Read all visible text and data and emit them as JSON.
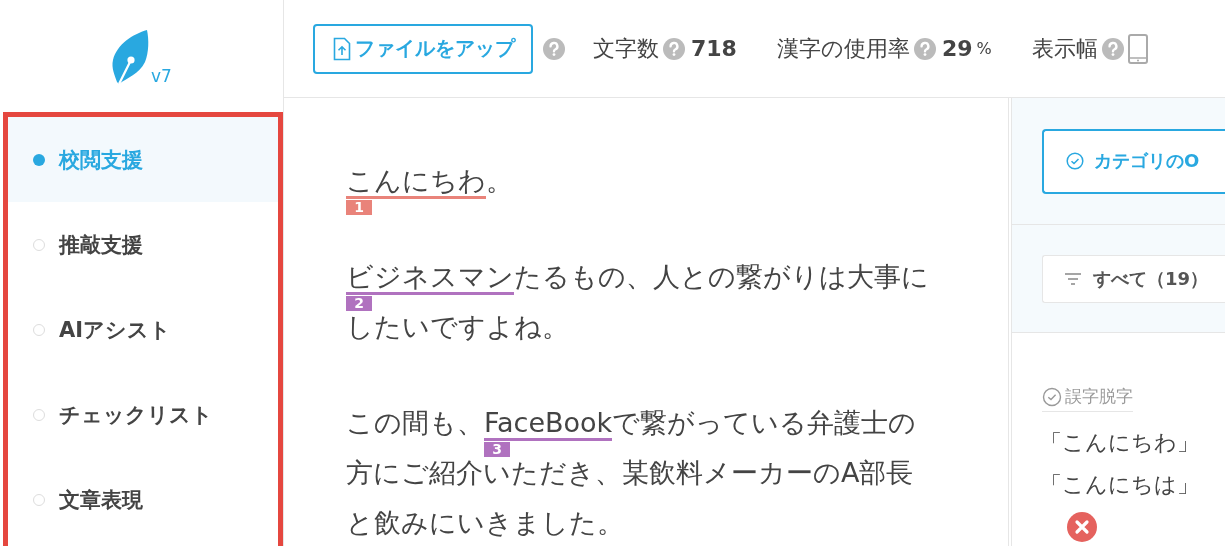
{
  "logo": {
    "version": "v7"
  },
  "sidebar": {
    "items": [
      {
        "label": "校閲支援",
        "selected": true
      },
      {
        "label": "推敲支援",
        "selected": false
      },
      {
        "label": "AIアシスト",
        "selected": false
      },
      {
        "label": "チェックリスト",
        "selected": false
      },
      {
        "label": "文章表現",
        "selected": false
      }
    ]
  },
  "toolbar": {
    "upload_button": "ファイルをアップ",
    "stats": [
      {
        "kind": "number",
        "label": "文字数",
        "value": "718"
      },
      {
        "kind": "number",
        "label": "漢字の使用率",
        "value": "29",
        "unit": "%"
      },
      {
        "kind": "device",
        "label": "表示幅"
      }
    ]
  },
  "document": {
    "paragraphs": [
      {
        "lines": [
          [
            {
              "text": "こんにちわ",
              "badge": "1",
              "color": "#e9837a"
            },
            {
              "text": "。"
            }
          ]
        ]
      },
      {
        "lines": [
          [
            {
              "text": "ビジネスマン",
              "badge": "2",
              "color": "#b072bf"
            },
            {
              "text": "たるもの、人との繋がりは大事に"
            }
          ],
          [
            {
              "text": "したいですよね。"
            }
          ]
        ]
      },
      {
        "lines": [
          [
            {
              "text": "この間も、"
            },
            {
              "text": "FaceBook",
              "badge": "3",
              "color": "#b072bf"
            },
            {
              "text": "で繋がっている弁護士の"
            }
          ],
          [
            {
              "text": "方にご紹介いただき、某飲料メーカーのA部長"
            }
          ],
          [
            {
              "text": "と飲みにいきました。"
            }
          ]
        ]
      }
    ]
  },
  "panel": {
    "category_button": "カテゴリのO",
    "filter": "すべて（19）",
    "suggestion": {
      "category": "誤字脱字",
      "original": "「こんにちわ」",
      "corrected": "「こんにちは」"
    }
  }
}
